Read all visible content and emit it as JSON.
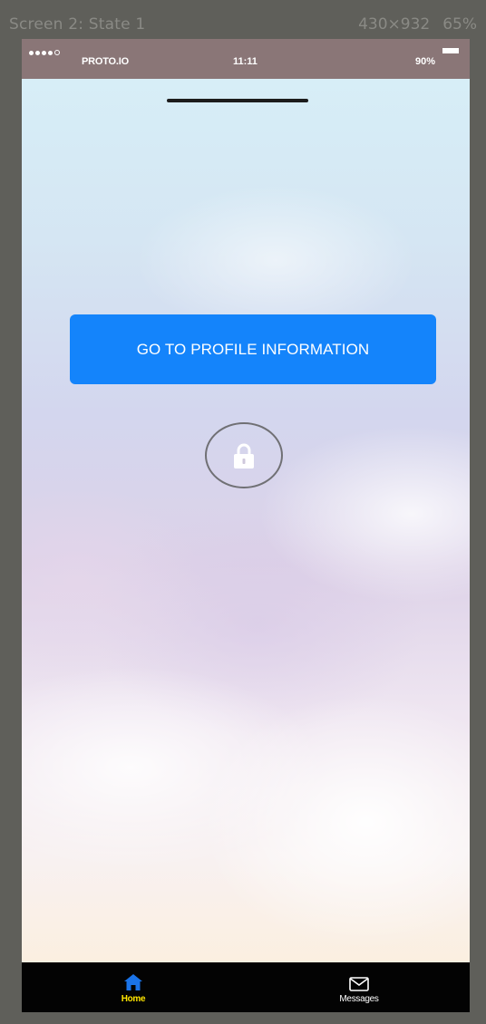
{
  "editor": {
    "screen_name": "Screen 2: State 1",
    "dimensions": "430×932",
    "zoom": "65%"
  },
  "statusbar": {
    "carrier": "PROTO.IO",
    "time": "11:11",
    "battery": "90%",
    "battery_level": 0.9
  },
  "main": {
    "cta_label": "GO TO PROFILE INFORMATION",
    "lock_icon": "lock-icon"
  },
  "tabbar": {
    "tabs": [
      {
        "label": "Home",
        "icon": "home-icon",
        "active": true,
        "color": "#ffe600"
      },
      {
        "label": "Messages",
        "icon": "envelope-icon",
        "active": false,
        "color": "#ffffff"
      }
    ]
  },
  "colors": {
    "accent": "#1484fb",
    "statusbar": "#8a7677",
    "tabbar": "#030303",
    "active_tab": "#ffe600",
    "home_icon": "#1a73e8"
  }
}
